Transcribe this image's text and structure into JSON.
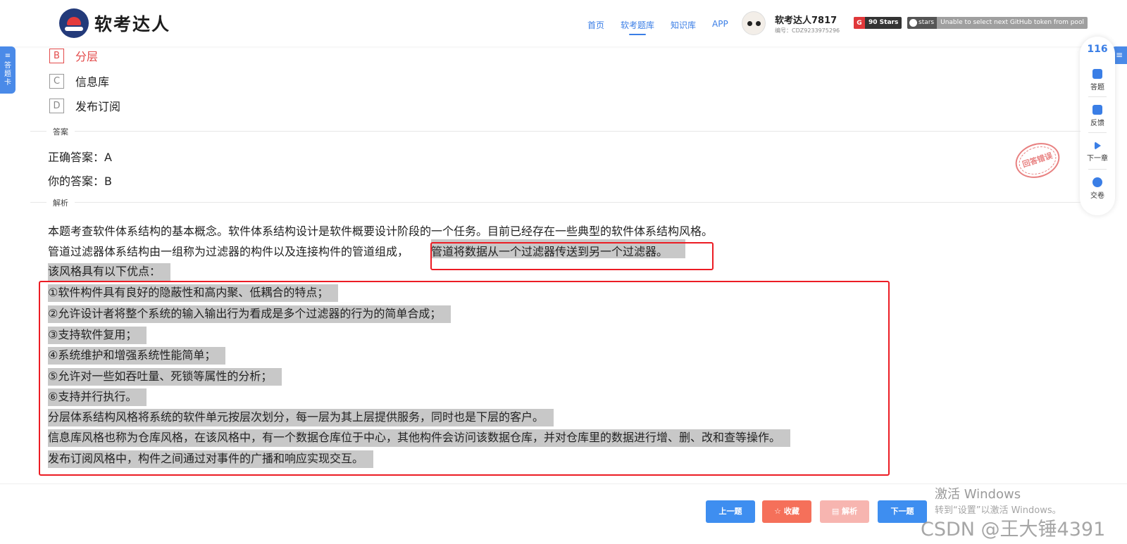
{
  "header": {
    "logo_text": "软考达人",
    "nav": [
      "首页",
      "软考题库",
      "知识库",
      "APP"
    ],
    "active_nav": "软考题库",
    "user_name": "软考达人7817",
    "user_id": "编号：CDZ9233975296",
    "stars_badge": "90 Stars",
    "github_label": "stars",
    "github_msg": "Unable to select next GitHub token from pool"
  },
  "left_tab": "答题卡",
  "right_tab_icon": "≡",
  "side_panel": {
    "count": "116",
    "items": [
      "答题",
      "反馈",
      "下一章",
      "交卷"
    ]
  },
  "options": [
    {
      "letter": "B",
      "text": "分层",
      "state": "wrong"
    },
    {
      "letter": "C",
      "text": "信息库",
      "state": "normal"
    },
    {
      "letter": "D",
      "text": "发布订阅",
      "state": "normal"
    }
  ],
  "answer_section": {
    "label": "答案",
    "correct": "正确答案：A",
    "yours": "你的答案：B",
    "stamp": "回答错误"
  },
  "analysis_section": {
    "label": "解析",
    "lines": [
      "本题考查软件体系结构的基本概念。软件体系结构设计是软件概要设计阶段的一个任务。目前已经存在一些典型的软件体系结构风格。",
      "管道过滤器体系结构由一组称为过滤器的构件以及连接构件的管道组成，",
      "管道将数据从一个过滤器传送到另一个过滤器。",
      "该风格具有以下优点：",
      "①软件构件具有良好的隐蔽性和高内聚、低耦合的特点；",
      "②允许设计者将整个系统的输入输出行为看成是多个过滤器的行为的简单合成；",
      "③支持软件复用；",
      "④系统维护和增强系统性能简单；",
      "⑤允许对一些如吞吐量、死锁等属性的分析；",
      "⑥支持并行执行。",
      "分层体系结构风格将系统的软件单元按层次划分，每一层为其上层提供服务，同时也是下层的客户。",
      "信息库风格也称为仓库风格，在该风格中，有一个数据仓库位于中心，其他构件会访问该数据仓库，并对仓库里的数据进行增、删、改和查等操作。",
      "发布订阅风格中，构件之间通过对事件的广播和响应实现交互。"
    ]
  },
  "buttons": {
    "prev": "上一题",
    "fav": "☆ 收藏",
    "analysis": "▤ 解析",
    "next": "下一题"
  },
  "watermark": {
    "activate_title": "激活 Windows",
    "activate_sub": "转到“设置”以激活 Windows。",
    "csdn": "CSDN @王大锤4391"
  },
  "colors": {
    "primary_blue": "#3e8ef0",
    "wrong_red": "#e34b4b",
    "highlight_gray": "#c8c8c8",
    "annotation_red": "#ec1c24"
  }
}
